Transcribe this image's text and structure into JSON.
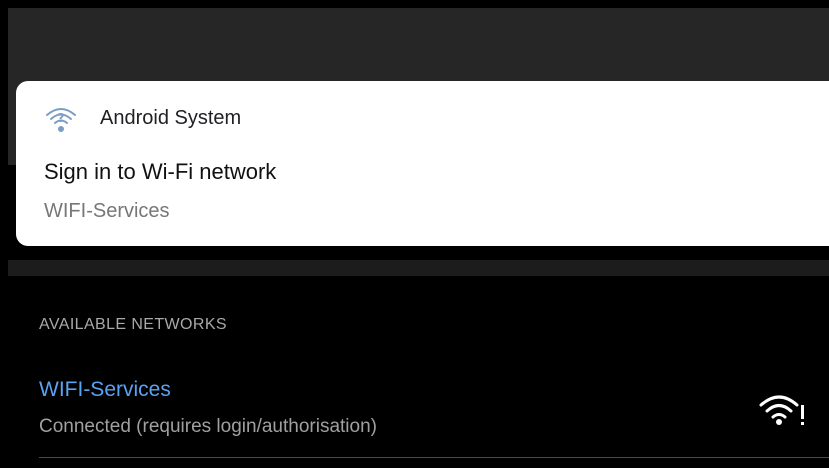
{
  "notification": {
    "app_icon": "wifi-question-icon",
    "app_name": "Android System",
    "title": "Sign in to Wi-Fi network",
    "text": "WIFI-Services"
  },
  "networks": {
    "section_header": "AVAILABLE NETWORKS",
    "items": [
      {
        "name": "WIFI-Services",
        "status": "Connected (requires login/authorisation)",
        "icon": "wifi-alert-icon"
      }
    ]
  },
  "colors": {
    "accent": "#5aa2f2",
    "background": "#000000",
    "notification_bg": "#ffffff",
    "icon_tint": "#7a9cc6"
  }
}
